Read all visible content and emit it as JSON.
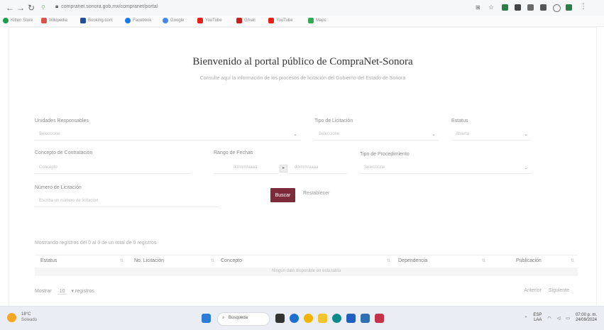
{
  "browser": {
    "url": "compranet.sonora.gob.mx/compranet/portal",
    "bookmarks": [
      "Kitten Store",
      "Wikipedia",
      "Booking.com",
      "Facebook",
      "Google",
      "YouTube",
      "Gmail",
      "YouTube",
      "Maps"
    ]
  },
  "page": {
    "title": "Bienvenido al portal público de CompraNet-Sonora",
    "subtitle": "Consulte aquí la información de los procesos de licitación del Gobierno del Estado de Sonora",
    "form": {
      "unidad_label": "Unidades Responsables",
      "unidad_value": "Seleccione",
      "tipo_label": "Tipo de Licitación",
      "tipo_value": "Seleccione",
      "estatus_label": "Estatus",
      "estatus_value": "Abierta",
      "concepto_label": "Concepto de Contratación",
      "concepto_placeholder": "Concepto",
      "rango_label": "Rango de Fechas",
      "fecha_inicio": "dd/mm/aaaa",
      "fecha_fin": "dd/mm/aaaa",
      "procedimiento_label": "Tipo de Procedimiento",
      "procedimiento_value": "Seleccione",
      "numero_label": "Número de Licitación",
      "numero_placeholder": "Escriba un número de licitación",
      "search_button": "Buscar",
      "clear_button": "Restablecer"
    },
    "table": {
      "note": "Mostrando registros del 0 al 0 de un total de 0 registros",
      "columns": [
        "Estatus",
        "No. Licitación",
        "Concepto",
        "Dependencia",
        "Publicación"
      ],
      "empty": "Ningún dato disponible en esta tabla",
      "show_label": "Mostrar",
      "page_size": "10",
      "records_label": "registros",
      "prev": "Anterior",
      "next": "Siguiente"
    }
  },
  "taskbar": {
    "weather_temp": "18°C",
    "weather_desc": "Soleado",
    "search": "Búsqueda",
    "lang": "ESP",
    "lang_sub": "LAA",
    "time": "07:00 p. m.",
    "date": "24/09/2024"
  }
}
